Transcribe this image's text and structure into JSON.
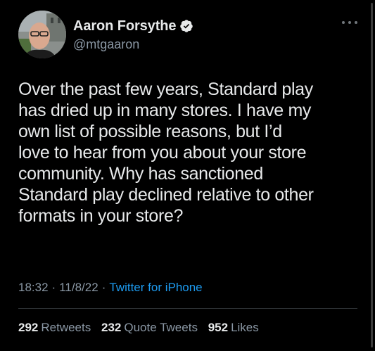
{
  "user": {
    "display_name": "Aaron Forsythe",
    "handle": "@mtgaaron",
    "verified": true
  },
  "icons": {
    "verified": "verified-badge-icon",
    "more": "more-options-icon"
  },
  "tweet": {
    "text": "Over the past few years, Standard play\nhas dried up in many stores. I have my\nown list of possible reasons, but I’d\nlove to hear from you about your store\ncommunity. Why has sanctioned\nStandard play declined relative to other\nformats in your store?",
    "time": "18:32",
    "separator": "·",
    "date": "11/8/22",
    "source": "Twitter for iPhone"
  },
  "stats": {
    "retweets_count": "292",
    "retweets_label": "Retweets",
    "quote_count": "232",
    "quote_label": "Quote Tweets",
    "likes_count": "952",
    "likes_label": "Likes"
  },
  "colors": {
    "background": "#000000",
    "text_primary": "#e7e9ea",
    "text_secondary": "#8b98a5",
    "link": "#1d9bf0",
    "divider": "#2f3336"
  }
}
